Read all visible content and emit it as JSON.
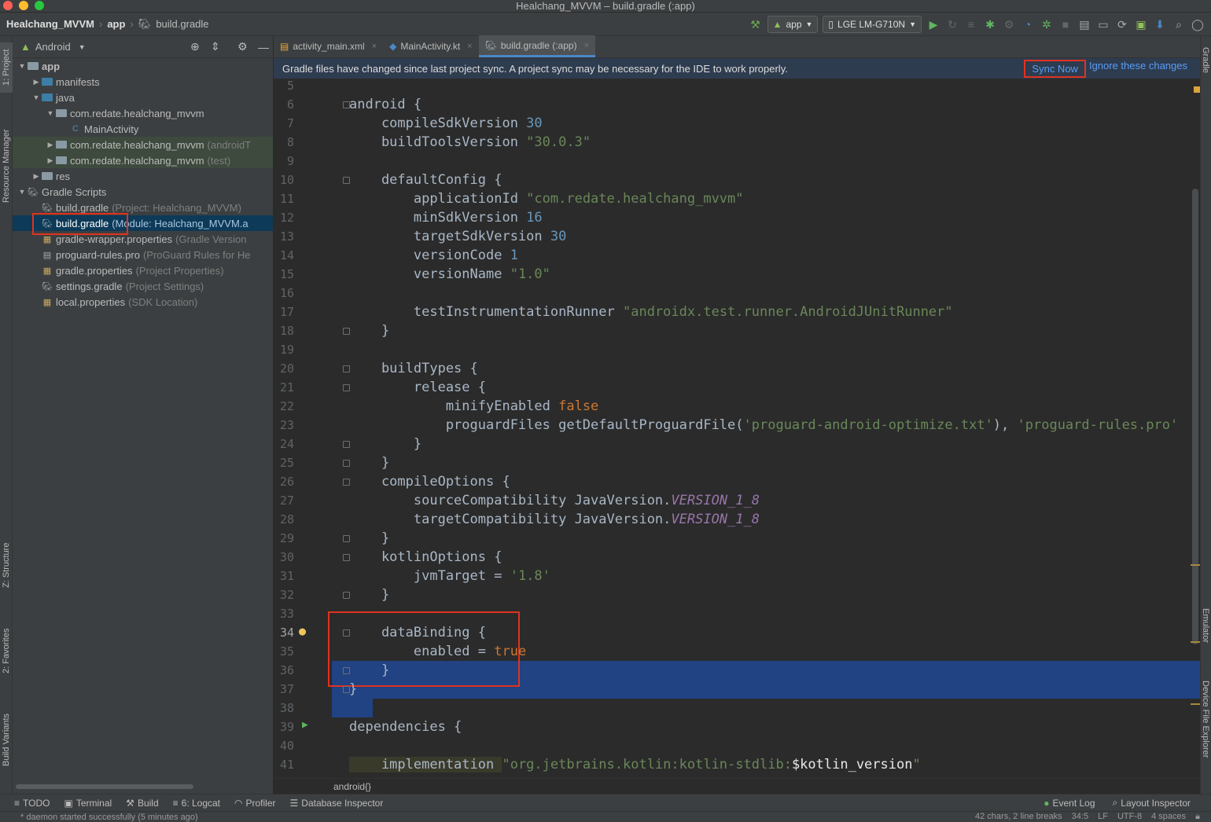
{
  "window": {
    "title": "Healchang_MVVM – build.gradle (:app)"
  },
  "breadcrumb": {
    "project": "Healchang_MVVM",
    "module": "app",
    "file": "build.gradle"
  },
  "toolbar": {
    "run_config": "app",
    "device": "LGE LM-G710N"
  },
  "project_panel": {
    "view_mode": "Android",
    "tree": [
      {
        "label": "app",
        "hint": "",
        "depth": 0,
        "arrow": "open",
        "icon": "module"
      },
      {
        "label": "manifests",
        "hint": "",
        "depth": 1,
        "arrow": "closed",
        "icon": "folder"
      },
      {
        "label": "java",
        "hint": "",
        "depth": 1,
        "arrow": "open",
        "icon": "folder"
      },
      {
        "label": "com.redate.healchang_mvvm",
        "hint": "",
        "depth": 2,
        "arrow": "open",
        "icon": "package"
      },
      {
        "label": "MainActivity",
        "hint": "",
        "depth": 3,
        "arrow": "",
        "icon": "kotlin"
      },
      {
        "label": "com.redate.healchang_mvvm",
        "hint": "(androidT",
        "depth": 2,
        "arrow": "closed",
        "icon": "package"
      },
      {
        "label": "com.redate.healchang_mvvm",
        "hint": "(test)",
        "depth": 2,
        "arrow": "closed",
        "icon": "package"
      },
      {
        "label": "res",
        "hint": "",
        "depth": 1,
        "arrow": "closed",
        "icon": "res"
      },
      {
        "label": "Gradle Scripts",
        "hint": "",
        "depth": 0,
        "arrow": "open",
        "icon": "gradle"
      },
      {
        "label": "build.gradle",
        "hint": "(Project: Healchang_MVVM)",
        "depth": 1,
        "arrow": "",
        "icon": "gradle"
      },
      {
        "label": "build.gradle",
        "hint": "(Module: Healchang_MVVM.a",
        "depth": 1,
        "arrow": "",
        "icon": "gradle"
      },
      {
        "label": "gradle-wrapper.properties",
        "hint": "(Gradle Version",
        "depth": 1,
        "arrow": "",
        "icon": "props"
      },
      {
        "label": "proguard-rules.pro",
        "hint": "(ProGuard Rules for He",
        "depth": 1,
        "arrow": "",
        "icon": "file"
      },
      {
        "label": "gradle.properties",
        "hint": "(Project Properties)",
        "depth": 1,
        "arrow": "",
        "icon": "props"
      },
      {
        "label": "settings.gradle",
        "hint": "(Project Settings)",
        "depth": 1,
        "arrow": "",
        "icon": "gradle"
      },
      {
        "label": "local.properties",
        "hint": "(SDK Location)",
        "depth": 1,
        "arrow": "",
        "icon": "props"
      }
    ]
  },
  "left_tabs": [
    "1: Project",
    "Resource Manager",
    "Z: Structure",
    "2: Favorites",
    "Build Variants"
  ],
  "right_tabs": [
    "Gradle",
    "Emulator",
    "Device File Explorer"
  ],
  "editor_tabs": [
    {
      "label": "activity_main.xml",
      "icon": "xml"
    },
    {
      "label": "MainActivity.kt",
      "icon": "kotlin"
    },
    {
      "label": "build.gradle (:app)",
      "icon": "gradle"
    }
  ],
  "banner": {
    "message": "Gradle files have changed since last project sync. A project sync may be necessary for the IDE to work properly.",
    "sync_now": "Sync Now",
    "ignore": "Ignore these changes"
  },
  "code_lines": [
    {
      "n": "5",
      "html": ""
    },
    {
      "n": "6",
      "html": "android {"
    },
    {
      "n": "7",
      "html": "    compileSdkVersion <n>30</n>"
    },
    {
      "n": "8",
      "html": "    buildToolsVersion <s>\"30.0.3\"</s>"
    },
    {
      "n": "9",
      "html": ""
    },
    {
      "n": "10",
      "html": "    defaultConfig {"
    },
    {
      "n": "11",
      "html": "        applicationId <s>\"com.redate.healchang_mvvm\"</s>"
    },
    {
      "n": "12",
      "html": "        minSdkVersion <n>16</n>"
    },
    {
      "n": "13",
      "html": "        targetSdkVersion <n>30</n>"
    },
    {
      "n": "14",
      "html": "        versionCode <n>1</n>"
    },
    {
      "n": "15",
      "html": "        versionName <s>\"1.0\"</s>"
    },
    {
      "n": "16",
      "html": ""
    },
    {
      "n": "17",
      "html": "        testInstrumentationRunner <s>\"androidx.test.runner.AndroidJUnitRunner\"</s>"
    },
    {
      "n": "18",
      "html": "    }"
    },
    {
      "n": "19",
      "html": ""
    },
    {
      "n": "20",
      "html": "    buildTypes {"
    },
    {
      "n": "21",
      "html": "        release {"
    },
    {
      "n": "22",
      "html": "            minifyEnabled <k>false</k>"
    },
    {
      "n": "23",
      "html": "            proguardFiles getDefaultProguardFile(<s>'proguard-android-optimize.txt'</s>), <s>'proguard-rules.pro'</s>"
    },
    {
      "n": "24",
      "html": "        }"
    },
    {
      "n": "25",
      "html": "    }"
    },
    {
      "n": "26",
      "html": "    compileOptions {"
    },
    {
      "n": "27",
      "html": "        sourceCompatibility JavaVersion.<i>VERSION_1_8</i>"
    },
    {
      "n": "28",
      "html": "        targetCompatibility JavaVersion.<i>VERSION_1_8</i>"
    },
    {
      "n": "29",
      "html": "    }"
    },
    {
      "n": "30",
      "html": "    kotlinOptions {"
    },
    {
      "n": "31",
      "html": "        jvmTarget = <s>'1.8'</s>"
    },
    {
      "n": "32",
      "html": "    }"
    },
    {
      "n": "33",
      "html": ""
    },
    {
      "n": "34",
      "html": "    dataBinding {"
    },
    {
      "n": "35",
      "html": "        enabled = <k>true</k>"
    },
    {
      "n": "36",
      "html": "    }"
    },
    {
      "n": "37",
      "html": "}"
    },
    {
      "n": "38",
      "html": ""
    },
    {
      "n": "39",
      "html": "dependencies {"
    },
    {
      "n": "40",
      "html": ""
    },
    {
      "n": "41",
      "html": "    implementation <s>\"org.jetbrains.kotlin:kotlin-stdlib:</s>$kotlin_version<s>\"</s>"
    }
  ],
  "editor_footer": "android{}",
  "bottom_tools": [
    {
      "label": "TODO",
      "icon": "≡"
    },
    {
      "label": "Terminal",
      "icon": "▣"
    },
    {
      "label": "Build",
      "icon": "⚒"
    },
    {
      "label": "6: Logcat",
      "icon": "≡"
    },
    {
      "label": "Profiler",
      "icon": "◠"
    },
    {
      "label": "Database Inspector",
      "icon": "☰"
    }
  ],
  "bottom_right_tools": [
    {
      "label": "Event Log",
      "icon": "●"
    },
    {
      "label": "Layout Inspector",
      "icon": "⌕"
    }
  ],
  "status": {
    "message": "* daemon started successfully (5 minutes ago)",
    "selection": "42 chars, 2 line breaks",
    "position": "34:5",
    "line_sep": "LF",
    "encoding": "UTF-8",
    "indent": "4 spaces"
  },
  "colors": {
    "accent": "#4a88c7",
    "selection": "#214283",
    "annotation_box": "#e0321f",
    "string": "#6a8759",
    "number": "#6897bb",
    "keyword": "#cc7832"
  }
}
